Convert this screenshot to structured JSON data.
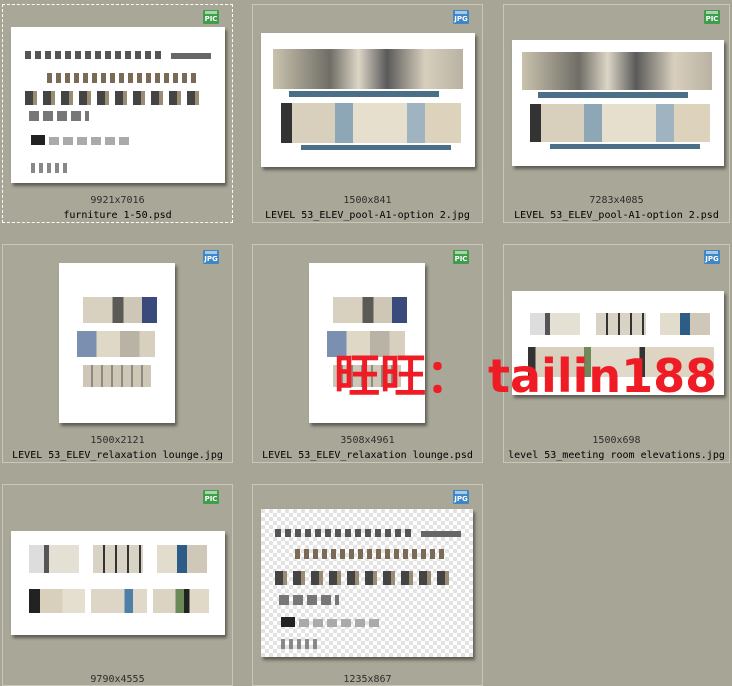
{
  "items": [
    {
      "filename": "furniture 1-50.psd",
      "dims": "9921x7016",
      "badge": "PIC",
      "selected": true
    },
    {
      "filename": "LEVEL 53_ELEV_pool-A1-option 2.jpg",
      "dims": "1500x841",
      "badge": "JPG",
      "selected": false
    },
    {
      "filename": "LEVEL 53_ELEV_pool-A1-option 2.psd",
      "dims": "7283x4085",
      "badge": "PIC",
      "selected": false
    },
    {
      "filename": "LEVEL 53_ELEV_relaxation lounge.jpg",
      "dims": "1500x2121",
      "badge": "JPG",
      "selected": false
    },
    {
      "filename": "LEVEL 53_ELEV_relaxation lounge.psd",
      "dims": "3508x4961",
      "badge": "PIC",
      "selected": false
    },
    {
      "filename": "level 53_meeting room elevations.jpg",
      "dims": "1500x698",
      "badge": "JPG",
      "selected": false
    },
    {
      "filename": "",
      "dims": "9790x4555",
      "badge": "PIC",
      "selected": false
    },
    {
      "filename": "",
      "dims": "1235x867",
      "badge": "JPG",
      "selected": false
    }
  ],
  "watermark": "旺旺： tailin188",
  "colors": {
    "background": "#a7a596",
    "pic_badge": "#3f9d4b",
    "jpg_badge": "#3f86c6",
    "watermark": "#ef1c25"
  }
}
